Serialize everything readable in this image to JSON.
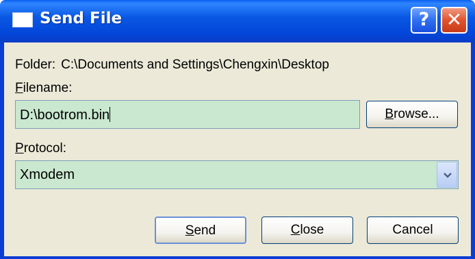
{
  "window": {
    "title": "Send File",
    "help_label": "?",
    "close_label": "✕"
  },
  "folder": {
    "label": "Folder:",
    "path": "C:\\Documents and Settings\\Chengxin\\Desktop"
  },
  "filename": {
    "label_mnemonic": "F",
    "label_rest": "ilename:",
    "value": "D:\\bootrom.bin"
  },
  "browse": {
    "mnemonic": "B",
    "rest": "rowse..."
  },
  "protocol": {
    "label_mnemonic": "P",
    "label_rest": "rotocol:",
    "selected": "Xmodem"
  },
  "buttons": {
    "send_mnemonic": "S",
    "send_rest": "end",
    "close_mnemonic": "C",
    "close_rest": "lose",
    "cancel": "Cancel"
  },
  "colors": {
    "titlebar": "#0a58e4",
    "client_bg": "#ece9d8",
    "field_bg": "#c9e8cf"
  }
}
